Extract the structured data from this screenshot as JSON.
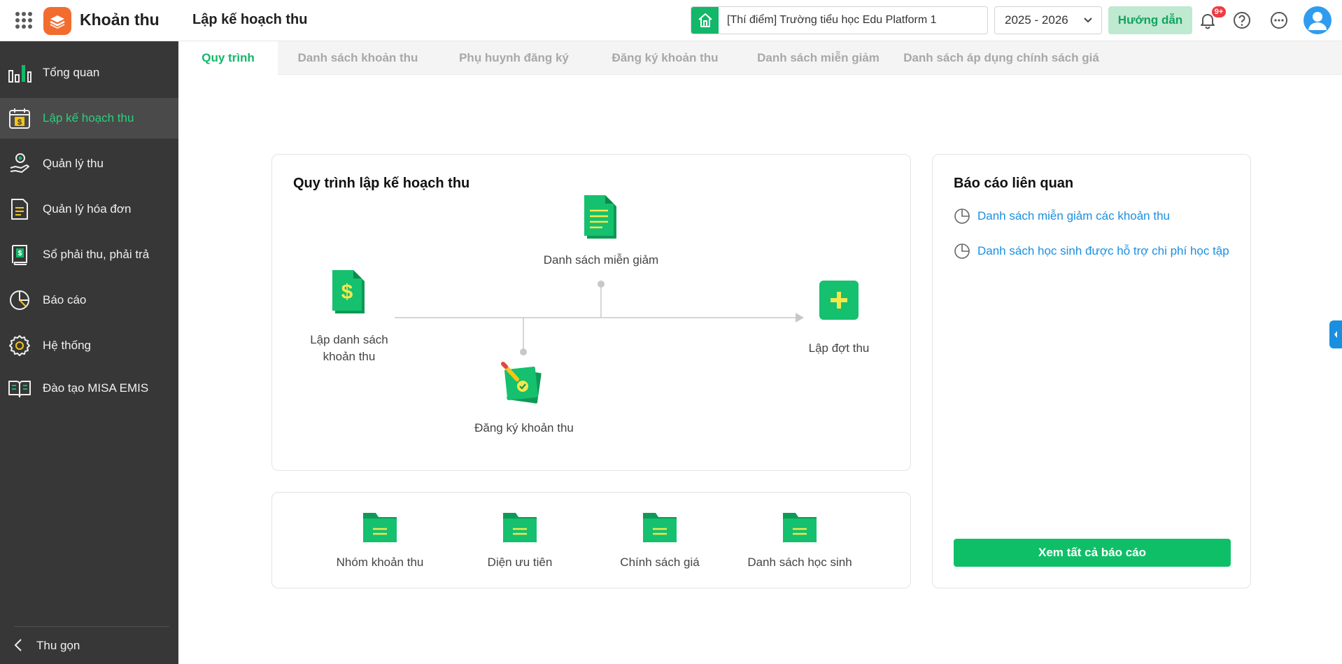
{
  "header": {
    "app_title": "Khoản thu",
    "page_title": "Lập kế hoạch thu",
    "school": "[Thí điểm] Trường tiểu học Edu Platform 1",
    "school_year": "2025 - 2026",
    "guide_label": "Hướng dẫn",
    "notification_badge": "9+"
  },
  "sidebar": {
    "items": [
      {
        "label": "Tổng quan",
        "icon": "bar-chart-icon"
      },
      {
        "label": "Lập kế hoạch thu",
        "icon": "calendar-dollar-icon",
        "active": true
      },
      {
        "label": "Quản lý thu",
        "icon": "hand-coin-icon"
      },
      {
        "label": "Quản lý hóa đơn",
        "icon": "invoice-icon"
      },
      {
        "label": "Sổ phải thu, phải trả",
        "icon": "ledger-book-icon"
      },
      {
        "label": "Báo cáo",
        "icon": "pie-chart-icon"
      },
      {
        "label": "Hệ thống",
        "icon": "gear-icon"
      },
      {
        "label": "Đào tạo MISA EMIS",
        "icon": "open-book-icon"
      }
    ],
    "collapse_label": "Thu gọn"
  },
  "tabs": [
    {
      "label": "Quy trình",
      "active": true
    },
    {
      "label": "Danh sách khoản thu"
    },
    {
      "label": "Phụ huynh đăng ký"
    },
    {
      "label": "Đăng ký khoản thu"
    },
    {
      "label": "Danh sách miễn giảm"
    },
    {
      "label": "Danh sách áp dụng chính sách giá"
    }
  ],
  "process": {
    "title": "Quy trình lập kế hoạch thu",
    "steps": {
      "create_list": "Lập danh sách khoản thu",
      "exemption_list": "Danh sách miễn giảm",
      "register": "Đăng ký khoản thu",
      "create_batch": "Lập đợt thu"
    }
  },
  "categories": [
    {
      "label": "Nhóm khoản thu"
    },
    {
      "label": "Diện ưu tiên"
    },
    {
      "label": "Chính sách giá"
    },
    {
      "label": "Danh sách học sinh"
    }
  ],
  "reports": {
    "title": "Báo cáo liên quan",
    "links": [
      {
        "label": "Danh sách miễn giảm các khoản thu"
      },
      {
        "label": "Danh sách học sinh được hỗ trợ chi phí học tập"
      }
    ],
    "view_all_label": "Xem tất cả báo cáo"
  },
  "colors": {
    "brand_green": "#12b76a",
    "sidebar_bg": "#373737",
    "link_blue": "#1a8fe0",
    "app_orange": "#f26c2f"
  }
}
